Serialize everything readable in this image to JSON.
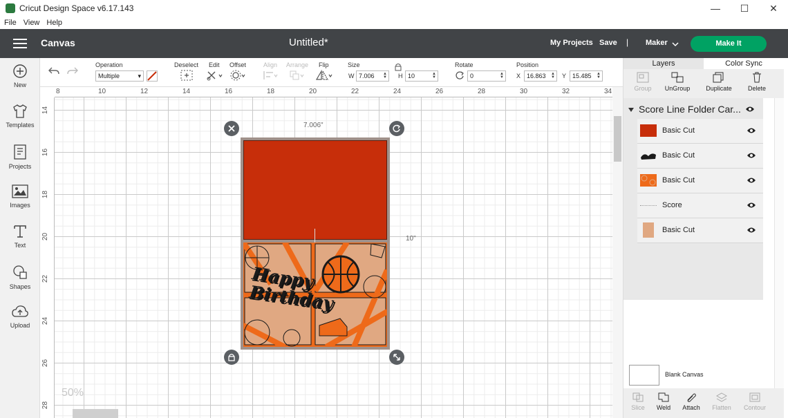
{
  "window": {
    "title": "Cricut Design Space  v6.17.143",
    "controls": [
      "—",
      "☐",
      "✕"
    ]
  },
  "menu": [
    "File",
    "View",
    "Help"
  ],
  "header": {
    "section": "Canvas",
    "doc_title": "Untitled*",
    "my_projects": "My Projects",
    "save": "Save",
    "separator": "|",
    "machine": "Maker",
    "make_it": "Make It"
  },
  "sidebar": [
    {
      "label": "New",
      "icon": "plus-circle-icon"
    },
    {
      "label": "Templates",
      "icon": "shirt-icon"
    },
    {
      "label": "Projects",
      "icon": "projects-icon"
    },
    {
      "label": "Images",
      "icon": "images-icon"
    },
    {
      "label": "Text",
      "icon": "text-icon"
    },
    {
      "label": "Shapes",
      "icon": "shapes-icon"
    },
    {
      "label": "Upload",
      "icon": "upload-icon"
    }
  ],
  "toolbar": {
    "operation_label": "Operation",
    "operation_value": "Multiple",
    "deselect": "Deselect",
    "edit": "Edit",
    "offset": "Offset",
    "align": "Align",
    "arrange": "Arrange",
    "flip": "Flip",
    "size_label": "Size",
    "w_label": "W",
    "w_value": "7.006",
    "h_label": "H",
    "h_value": "10",
    "rotate_label": "Rotate",
    "rotate_value": "0",
    "position_label": "Position",
    "x_label": "X",
    "x_value": "16.863",
    "y_label": "Y",
    "y_value": "15.485"
  },
  "canvas": {
    "h_ruler": [
      "8",
      "10",
      "12",
      "14",
      "16",
      "18",
      "20",
      "22",
      "24",
      "26",
      "28",
      "30",
      "32",
      "34"
    ],
    "v_ruler": [
      "14",
      "16",
      "18",
      "20",
      "22",
      "24",
      "26",
      "28"
    ],
    "width_dim": "7.006\"",
    "height_dim": "10\"",
    "zoom": "50%",
    "card_text": "Happy Birthday"
  },
  "panel": {
    "tabs": [
      "Layers",
      "Color Sync"
    ],
    "actions": [
      {
        "label": "Group",
        "enabled": false
      },
      {
        "label": "UnGroup",
        "enabled": true
      },
      {
        "label": "Duplicate",
        "enabled": true
      },
      {
        "label": "Delete",
        "enabled": true
      }
    ],
    "group_name": "Score Line Folder Car...",
    "layers": [
      {
        "name": "Basic Cut",
        "color": "#c72e0a"
      },
      {
        "name": "Basic Cut",
        "color": "#1a1a1a"
      },
      {
        "name": "Basic Cut",
        "color": "#ee6a1a"
      },
      {
        "name": "Score",
        "color": "#aaaaaa"
      },
      {
        "name": "Basic Cut",
        "color": "#e0a882"
      }
    ],
    "blank_canvas": "Blank Canvas",
    "bottom_actions": [
      {
        "label": "Slice",
        "enabled": false
      },
      {
        "label": "Weld",
        "enabled": true
      },
      {
        "label": "Attach",
        "enabled": true
      },
      {
        "label": "Flatten",
        "enabled": false
      },
      {
        "label": "Contour",
        "enabled": false
      }
    ]
  },
  "colors": {
    "header_bg": "#414447",
    "make_it": "#00a263",
    "card_top": "#c72e0a",
    "card_bottom": "#ee6a1a",
    "card_tan": "#e0a882"
  }
}
